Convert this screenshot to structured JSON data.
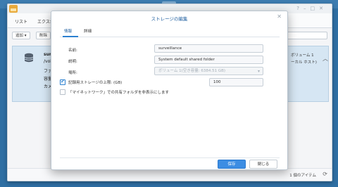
{
  "background_window": {
    "tabs": [
      "リスト",
      "エクスポ"
    ],
    "toolbar": {
      "add_label": "追加 ▾",
      "delete_label": "削除"
    },
    "row": {
      "name": "surve",
      "path": "/volu",
      "line1": "ファイ",
      "line2": "容量",
      "line3": "カメラ",
      "right1": "ボリューム 1",
      "right2": "ーカル ホスト)"
    },
    "footer": {
      "count": "1 個のアイテム"
    }
  },
  "modal": {
    "title": "ストレージの編集",
    "tabs": {
      "info": "情報",
      "detail": "詳細"
    },
    "fields": {
      "name_label": "名前:",
      "name_value": "surveillance",
      "desc_label": "説明:",
      "desc_value": "System default shared folder",
      "location_label": "場所:",
      "location_value": "ボリューム 1(空き容量: 6384.51 GB)"
    },
    "quota": {
      "label": "記録用ストレージの上限: (GB)",
      "value": "100",
      "checked": true
    },
    "network_folder": {
      "label": "「マイネットワーク」での共有フォルダを非表示にします",
      "checked": false
    },
    "buttons": {
      "save": "保存",
      "close": "閉じる"
    }
  },
  "colors": {
    "accent": "#3c8de3",
    "desktop": "#2f6fa3",
    "selection": "#d6e6f3"
  }
}
